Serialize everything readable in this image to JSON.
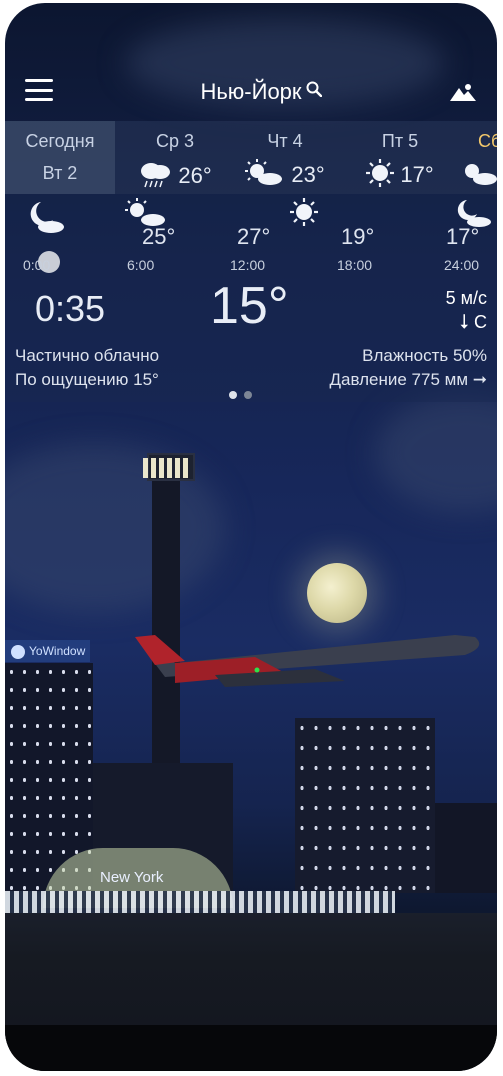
{
  "header": {
    "city": "Нью-Йорк",
    "icons": [
      "menu-icon",
      "search-icon",
      "landscape-icon"
    ]
  },
  "days": [
    {
      "name": "Сегодня",
      "sub": "Вт 2"
    },
    {
      "name": "Ср 3",
      "temp": "26°",
      "icon": "rain-cloud-icon"
    },
    {
      "name": "Чт 4",
      "temp": "23°",
      "icon": "sun-cloud-icon"
    },
    {
      "name": "Пт 5",
      "temp": "17°",
      "icon": "sun-icon"
    },
    {
      "name": "Сб",
      "icon": "sun-cloud-icon"
    }
  ],
  "hourly": [
    {
      "time": "0:00",
      "temp": "",
      "icon": "moon-cloud-icon"
    },
    {
      "time": "6:00",
      "temp": "25°",
      "icon": "sun-cloud-icon"
    },
    {
      "time": "12:00",
      "temp": "27°",
      "icon": "sun-icon"
    },
    {
      "time": "18:00",
      "temp": "19°",
      "icon": "sun-icon"
    },
    {
      "time": "24:00",
      "temp": "17°",
      "icon": "moon-cloud-icon"
    }
  ],
  "current": {
    "time": "0:35",
    "temp": "15°",
    "wind_speed": "5 м/с",
    "wind_dir": "С",
    "condition": "Частично облачно",
    "feels_like": "По ощущению 15°",
    "humidity": "Влажность 50%",
    "pressure": "Давление 775 мм"
  },
  "scene": {
    "badge": "YoWindow",
    "city_label": "New York"
  },
  "colors": {
    "sky_top": "#0c1630",
    "sky_mid": "#1a2c63",
    "panel": "#28375a",
    "text": "#e8edf6",
    "sun": "#f1f4fa"
  }
}
